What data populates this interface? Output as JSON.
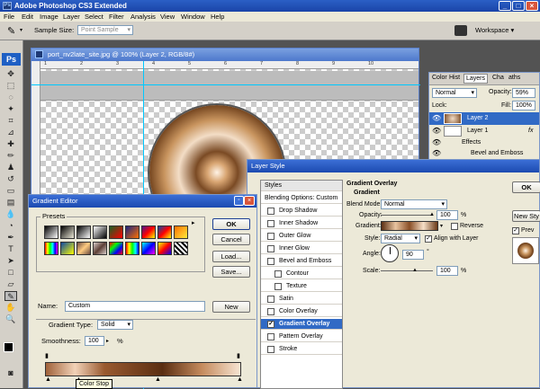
{
  "app": {
    "title": "Adobe Photoshop CS3 Extended",
    "logo": "Ps"
  },
  "menu": [
    "File",
    "Edit",
    "Image",
    "Layer",
    "Select",
    "Filter",
    "Analysis",
    "View",
    "Window",
    "Help"
  ],
  "options_bar": {
    "sample_size_label": "Sample Size:",
    "sample_size_value": "Point Sample",
    "workspace_label": "Workspace ▾"
  },
  "toolbox": {
    "badge": "Ps"
  },
  "document": {
    "title": "port_nv2late_site.jpg @ 100% (Layer 2, RGB/8#)",
    "ruler_ticks": [
      "1",
      "2",
      "3",
      "4",
      "5",
      "6",
      "7",
      "8",
      "9",
      "10"
    ]
  },
  "layers_panel": {
    "tabs": [
      "Color",
      "Hist",
      "Layers",
      "Cha",
      "aths"
    ],
    "blend_mode": "Normal",
    "opacity_label": "Opacity:",
    "opacity_value": "59%",
    "lock_label": "Lock:",
    "fill_label": "Fill:",
    "fill_value": "100%",
    "layers": [
      "Layer 2",
      "Layer 1"
    ],
    "effects_label": "Effects",
    "effect_item": "Bevel and Emboss",
    "fx": "fx"
  },
  "layer_style": {
    "title": "Layer Style",
    "styles_header": "Styles",
    "blending_options": "Blending Options: Custom",
    "items": [
      "Drop Shadow",
      "Inner Shadow",
      "Outer Glow",
      "Inner Glow",
      "Bevel and Emboss",
      "Contour",
      "Texture",
      "Satin",
      "Color Overlay",
      "Gradient Overlay",
      "Pattern Overlay",
      "Stroke"
    ],
    "section_title": "Gradient Overlay",
    "group_title": "Gradient",
    "blend_mode_label": "Blend Mode:",
    "blend_mode_value": "Normal",
    "opacity_label": "Opacity:",
    "opacity_value": "100",
    "gradient_label": "Gradient:",
    "reverse_label": "Reverse",
    "style_label": "Style:",
    "style_value": "Radial",
    "align_label": "Align with Layer",
    "angle_label": "Angle:",
    "angle_value": "90",
    "scale_label": "Scale:",
    "scale_value": "100",
    "percent": "%",
    "degree": "°",
    "ok": "OK",
    "new_style": "New Sty",
    "preview": "Prev"
  },
  "gradient_editor": {
    "title": "Gradient Editor",
    "presets_label": "Presets",
    "ok": "OK",
    "cancel": "Cancel",
    "load": "Load...",
    "save": "Save...",
    "name_label": "Name:",
    "name_value": "Custom",
    "new_button": "New",
    "gradient_type_label": "Gradient Type:",
    "gradient_type_value": "Solid",
    "smoothness_label": "Smoothness:",
    "smoothness_value": "100",
    "percent": "%",
    "tooltip": "Color Stop"
  },
  "colors": {
    "title_blue": "#1c4ab0",
    "dialog_bg": "#ece9d8",
    "selected": "#316ac5",
    "copper": "#a0623a"
  }
}
